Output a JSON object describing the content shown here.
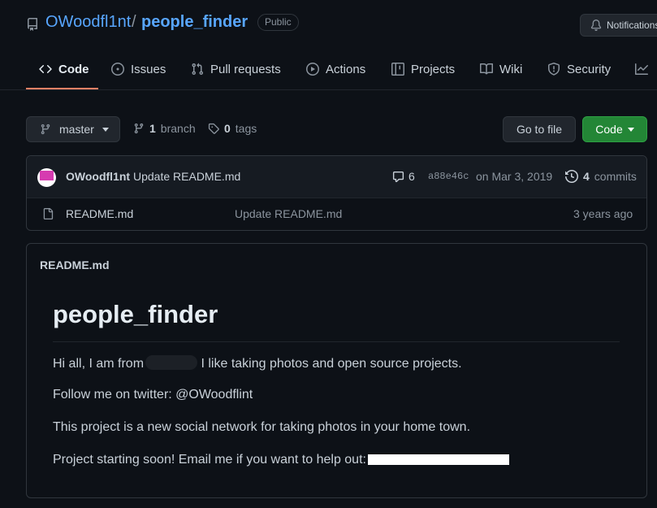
{
  "repo": {
    "owner": "OWoodfl1nt",
    "separator": "/",
    "name": "people_finder",
    "visibility": "Public"
  },
  "header": {
    "notifications_label": "Notifications"
  },
  "tabs": [
    {
      "label": "Code",
      "icon": "code-icon"
    },
    {
      "label": "Issues",
      "icon": "issue-opened-icon"
    },
    {
      "label": "Pull requests",
      "icon": "git-pull-request-icon"
    },
    {
      "label": "Actions",
      "icon": "play-icon"
    },
    {
      "label": "Projects",
      "icon": "table-icon"
    },
    {
      "label": "Wiki",
      "icon": "book-icon"
    },
    {
      "label": "Security",
      "icon": "shield-icon"
    }
  ],
  "toolbar": {
    "branch": "master",
    "branch_count": "1",
    "branch_label": "branch",
    "tag_count": "0",
    "tag_label": "tags",
    "go_to_file": "Go to file",
    "code_button": "Code"
  },
  "latest_commit": {
    "author": "OWoodfl1nt",
    "message": "Update README.md",
    "comments": "6",
    "sha": "a88e46c",
    "date": "on Mar 3, 2019",
    "commit_count": "4",
    "commit_label": "commits"
  },
  "files": [
    {
      "name": "README.md",
      "last_commit": "Update README.md",
      "age": "3 years ago"
    }
  ],
  "readme": {
    "filename": "README.md",
    "heading": "people_finder",
    "p1_start": "Hi all, I am from",
    "p1_end": "I like taking photos and open source projects.",
    "p2": "Follow me on twitter: @OWoodflint",
    "p3": "This project is a new social network for taking photos in your home town.",
    "p4": "Project starting soon! Email me if you want to help out:"
  },
  "colors": {
    "background": "#0d1117",
    "link": "#58a6ff",
    "primary_button": "#238636",
    "active_tab_underline": "#f78166"
  }
}
